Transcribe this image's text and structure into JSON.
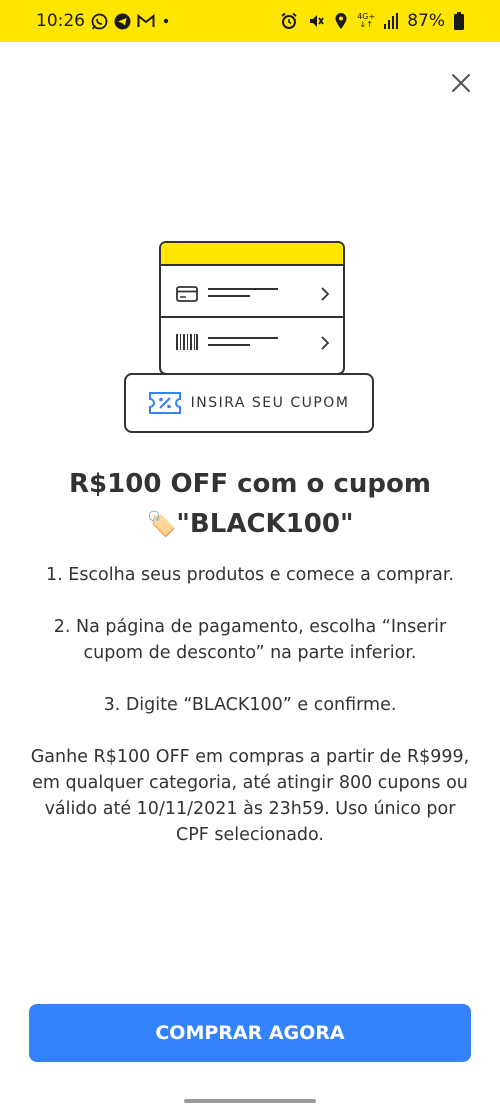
{
  "status_bar": {
    "time": "10:26",
    "battery": "87%",
    "network": "4G+",
    "left_icons": [
      "whatsapp-icon",
      "telegram-icon",
      "gmail-icon",
      "dot-icon"
    ],
    "right_icons": [
      "alarm-icon",
      "mute-vibrate-icon",
      "location-icon",
      "network-icon",
      "signal-icon",
      "battery-icon"
    ]
  },
  "modal": {
    "close_icon": "close-icon",
    "illustration": {
      "coupon_button_label": "INSIRA SEU CUPOM",
      "coupon_icon": "coupon-icon",
      "rows": [
        "card-icon",
        "barcode-icon"
      ],
      "accent": "#FFE600"
    },
    "title_line1": "R$100 OFF com o cupom",
    "title_line2": "\"BLACK100\"",
    "title_emoji": "🏷️",
    "steps": [
      "1. Escolha seus produtos e comece a comprar.",
      "2. Na página de pagamento, escolha “Inserir cupom de desconto” na parte inferior.",
      "3. Digite “BLACK100” e confirme."
    ],
    "terms": "Ganhe R$100 OFF em compras a partir de R$999, em qualquer categoria, até atingir 800 cupons ou válido até 10/11/2021 às 23h59. Uso único por CPF selecionado.",
    "cta_label": "COMPRAR AGORA",
    "cta_color": "#3483FA"
  }
}
